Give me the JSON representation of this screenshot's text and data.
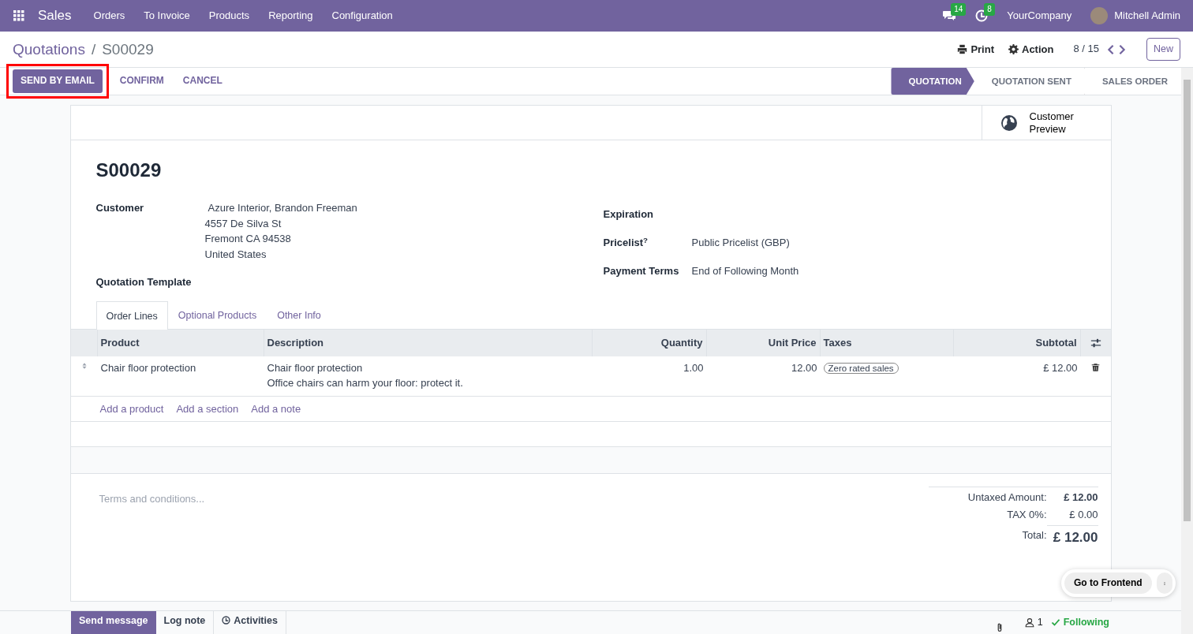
{
  "navbar": {
    "app_name": "Sales",
    "menus": [
      "Orders",
      "To Invoice",
      "Products",
      "Reporting",
      "Configuration"
    ],
    "messages_count": "14",
    "activities_count": "8",
    "company": "YourCompany",
    "user": "Mitchell Admin"
  },
  "breadcrumb": {
    "parent": "Quotations",
    "separator": "/",
    "current": "S00029"
  },
  "control_actions": {
    "print": "Print",
    "action": "Action",
    "pager": "8 / 15",
    "new_button": "New"
  },
  "buttons": [
    {
      "label": "SEND BY EMAIL",
      "kind": "primary",
      "highlighted": true
    },
    {
      "label": "CONFIRM",
      "kind": "secondary",
      "highlighted": false
    },
    {
      "label": "CANCEL",
      "kind": "secondary",
      "highlighted": false
    }
  ],
  "statusbar": [
    {
      "label": "QUOTATION",
      "selected": true
    },
    {
      "label": "QUOTATION SENT",
      "selected": false
    },
    {
      "label": "SALES ORDER",
      "selected": false
    }
  ],
  "smart_button": "Customer Preview",
  "title": "S00029",
  "left_fields": [
    {
      "label": "Customer",
      "value": "Azure Interior, Brandon Freeman",
      "address": [
        "4557 De Silva St",
        "Fremont CA 94538",
        "United States"
      ]
    },
    {
      "label": "Quotation Template"
    }
  ],
  "right_fields": [
    {
      "label": "Expiration"
    },
    {
      "label": "Pricelist$^{?}$",
      "value": "Public Pricelist (GBP)"
    },
    {
      "label": "Payment Terms",
      "value": "End of Following Month"
    }
  ],
  "tabs": [
    {
      "label": "Order Lines",
      "selected": true
    },
    {
      "label": "Optional Products",
      "selected": false
    },
    {
      "label": "Other Info",
      "selected": false
    }
  ],
  "table": {
    "columns": [
      "Product",
      "Description",
      "Quantity",
      "Unit Price",
      "Taxes",
      "Subtotal"
    ],
    "rows": [
      {
        "product": "Chair floor protection",
        "description": [
          "Chair floor protection",
          "Office chairs can harm your floor: protect it."
        ],
        "quantity": "1.00",
        "unit_price": "12.00",
        "taxes": "Zero rated sales",
        "subtotal": "£ 12.00"
      }
    ],
    "add_links": [
      "Add a product",
      "Add a section",
      "Add a note"
    ]
  },
  "terms_placeholder": "Terms and conditions...",
  "totals": [
    {
      "label": "Untaxed Amount:",
      "value": "£ 12.00",
      "kind": "strong"
    },
    {
      "label": "TAX 0%:",
      "value": "£ 0.00",
      "kind": "plain"
    },
    {
      "label": "Total:",
      "value": "£ 12.00",
      "kind": "total"
    }
  ],
  "floating": {
    "button": "Go to Frontend"
  },
  "chatter": {
    "tabs": [
      {
        "label": "Send message",
        "selected": true
      },
      {
        "label": "Log note",
        "selected": false
      },
      {
        "label": "Activities",
        "selected": false
      }
    ],
    "followers": "1",
    "follow_state": "Following"
  }
}
